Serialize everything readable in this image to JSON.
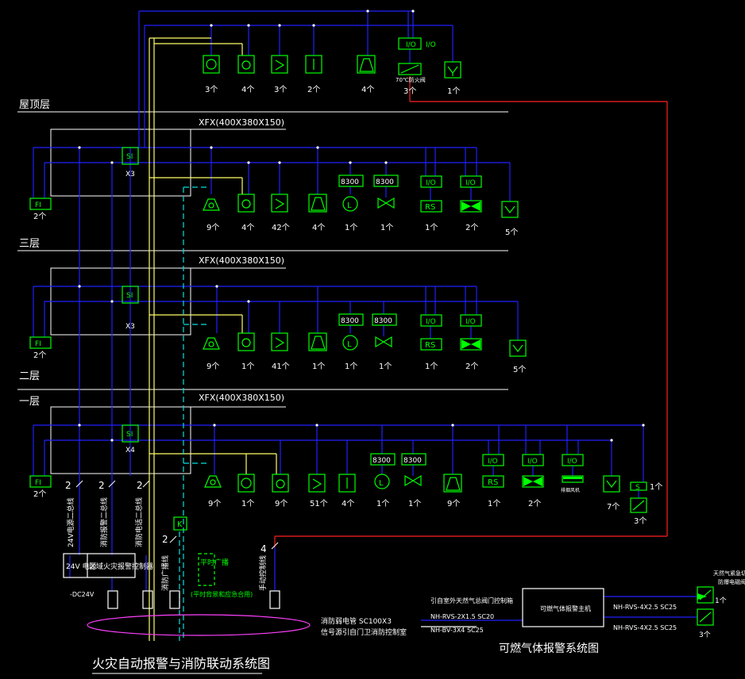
{
  "floors": {
    "roof": "屋顶层",
    "third": "三层",
    "second": "二层",
    "first": "一层"
  },
  "boxes": {
    "third": "XFX(400X380X150)",
    "second": "XFX(400X380X150)",
    "first": "XFX(400X380X150)"
  },
  "modules": {
    "si": "SI",
    "fi": "FI",
    "io": "I/O",
    "rs": "RS",
    "k": "K",
    "s": "S"
  },
  "box_tags": [
    "X3",
    "X3",
    "X4"
  ],
  "codes": {
    "a": "8300",
    "b": "8300"
  },
  "roof_counts": [
    "3个",
    "4个",
    "3个",
    "2个",
    "4个",
    "3个",
    "1个"
  ],
  "roof_valve_label": "70℃防火阀",
  "third_counts": [
    "9个",
    "4个",
    "42个",
    "4个",
    "1个",
    "1个",
    "1个",
    "2个",
    "5个"
  ],
  "second_counts": [
    "9个",
    "1个",
    "41个",
    "1个",
    "1个",
    "1个",
    "1个",
    "2个",
    "5个"
  ],
  "first_counts": [
    "9个",
    "1个",
    "9个",
    "51个",
    "4个",
    "1个",
    "1个",
    "9个",
    "1个",
    "2个",
    "7个",
    "1个",
    "3个"
  ],
  "fi_counts": [
    "2个",
    "2个",
    "2个"
  ],
  "fan_label": "排烟风机",
  "bus_counts": [
    "2",
    "2",
    "2",
    "2",
    "4"
  ],
  "cables": {
    "c1": "24V电源二总线",
    "c2": "消防报警二总线",
    "c3": "消防电话二总线",
    "c4": "消防广播线",
    "c5": "手动控制线"
  },
  "panel": {
    "power": "24V 电源",
    "controller": "区域火灾报警控制器",
    "dc": "-DC24V"
  },
  "amp": {
    "label": "平时广播",
    "note": "(平时背景和应急合用)"
  },
  "conduit": {
    "line1": "消防弱电管  SC100X3",
    "line2": "信号源引自门卫消防控制室"
  },
  "gas": {
    "controller": "可燃气体报警主机",
    "lead1": "引自室外天然气总阀门控制箱",
    "lead2": "NH-RVS-2X1.5  SC20",
    "lead3": "NH-BV-3X4   SC25",
    "out1": "NH-RVS-4X2.5  SC25",
    "out2": "NH-RVS-4X2.5  SC25",
    "valve_label": "天然气紧急切断阀",
    "valve_label2": "防爆电磁阀",
    "valve_count": "1个",
    "detector_count": "3个",
    "title": "可燃气体报警系统图"
  },
  "title": "火灾自动报警与消防联动系统图"
}
